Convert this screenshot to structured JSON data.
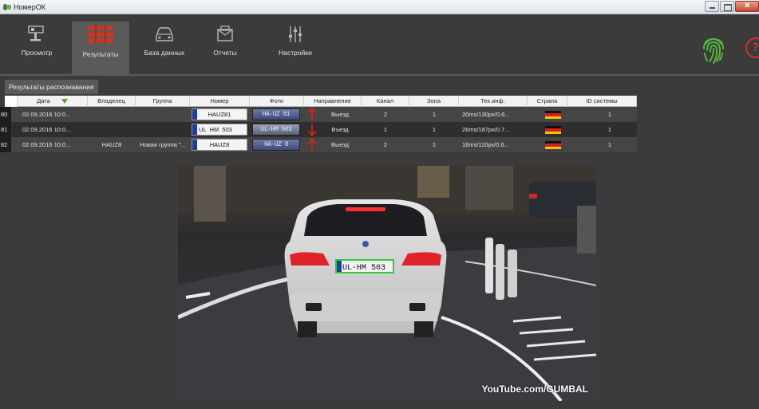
{
  "window": {
    "title": "НомерОК",
    "controls": [
      "minimize-icon",
      "maximize-icon",
      "close-icon"
    ]
  },
  "toolbar": {
    "items": [
      {
        "label": "Просмотр",
        "icon": "camera-icon",
        "active": false
      },
      {
        "label": "Результаты",
        "icon": "results-icon",
        "active": true
      },
      {
        "label": "База данных",
        "icon": "car-icon",
        "active": false
      },
      {
        "label": "Отчеты",
        "icon": "reports-icon",
        "active": false
      },
      {
        "label": "Настройки",
        "icon": "sliders-icon",
        "active": false
      }
    ],
    "status_icon": "fingerprint-icon",
    "help_icon": "help-icon",
    "help_glyph": "?",
    "accent_color": "#56b83a"
  },
  "tab": {
    "label": "Результаты распознавания"
  },
  "table": {
    "columns": [
      "Дата",
      "Владелец",
      "Группа",
      "Номер",
      "Фото",
      "Направление",
      "Канал",
      "Зона",
      "Тех.инф.",
      "Страна",
      "ID системы"
    ],
    "rows": [
      {
        "idx": "80",
        "date": "02.09.2016 10:0...",
        "owner": "",
        "group": "",
        "plate": "HAUZ81",
        "photo_text": "HA·UZ 81",
        "direction": "Выезд",
        "dir_arrow": "up",
        "channel": "2",
        "zone": "1",
        "tech": "20ms/130px/0.6...",
        "country_flag": "germany-flag",
        "system_id": "1"
      },
      {
        "idx": "81",
        "date": "02.09.2016 10:0...",
        "owner": "",
        "group": "",
        "plate": "UL  HM  503",
        "photo_text": "UL·HM 503",
        "direction": "Въезд",
        "dir_arrow": "down",
        "channel": "1",
        "zone": "1",
        "tech": "26ms/187px/0.7...",
        "country_flag": "germany-flag",
        "system_id": "1"
      },
      {
        "idx": "82",
        "date": "02.09.2016 10:0...",
        "owner": "HAUZ8",
        "group": "Новая группа \"...",
        "plate": "HAUZ8",
        "photo_text": "HA·UZ 8",
        "direction": "Выезд",
        "dir_arrow": "up",
        "channel": "2",
        "zone": "1",
        "tech": "16ms/110px/0.6...",
        "country_flag": "germany-flag",
        "system_id": "1"
      }
    ],
    "colors": {
      "arrow_up": "#d9241c",
      "arrow_down": "#d9241c",
      "plate_outline": "#2ecc40"
    }
  },
  "image": {
    "detected_plate": "UL·HM 503",
    "watermark": "YouTube.com/GUMBAL"
  }
}
